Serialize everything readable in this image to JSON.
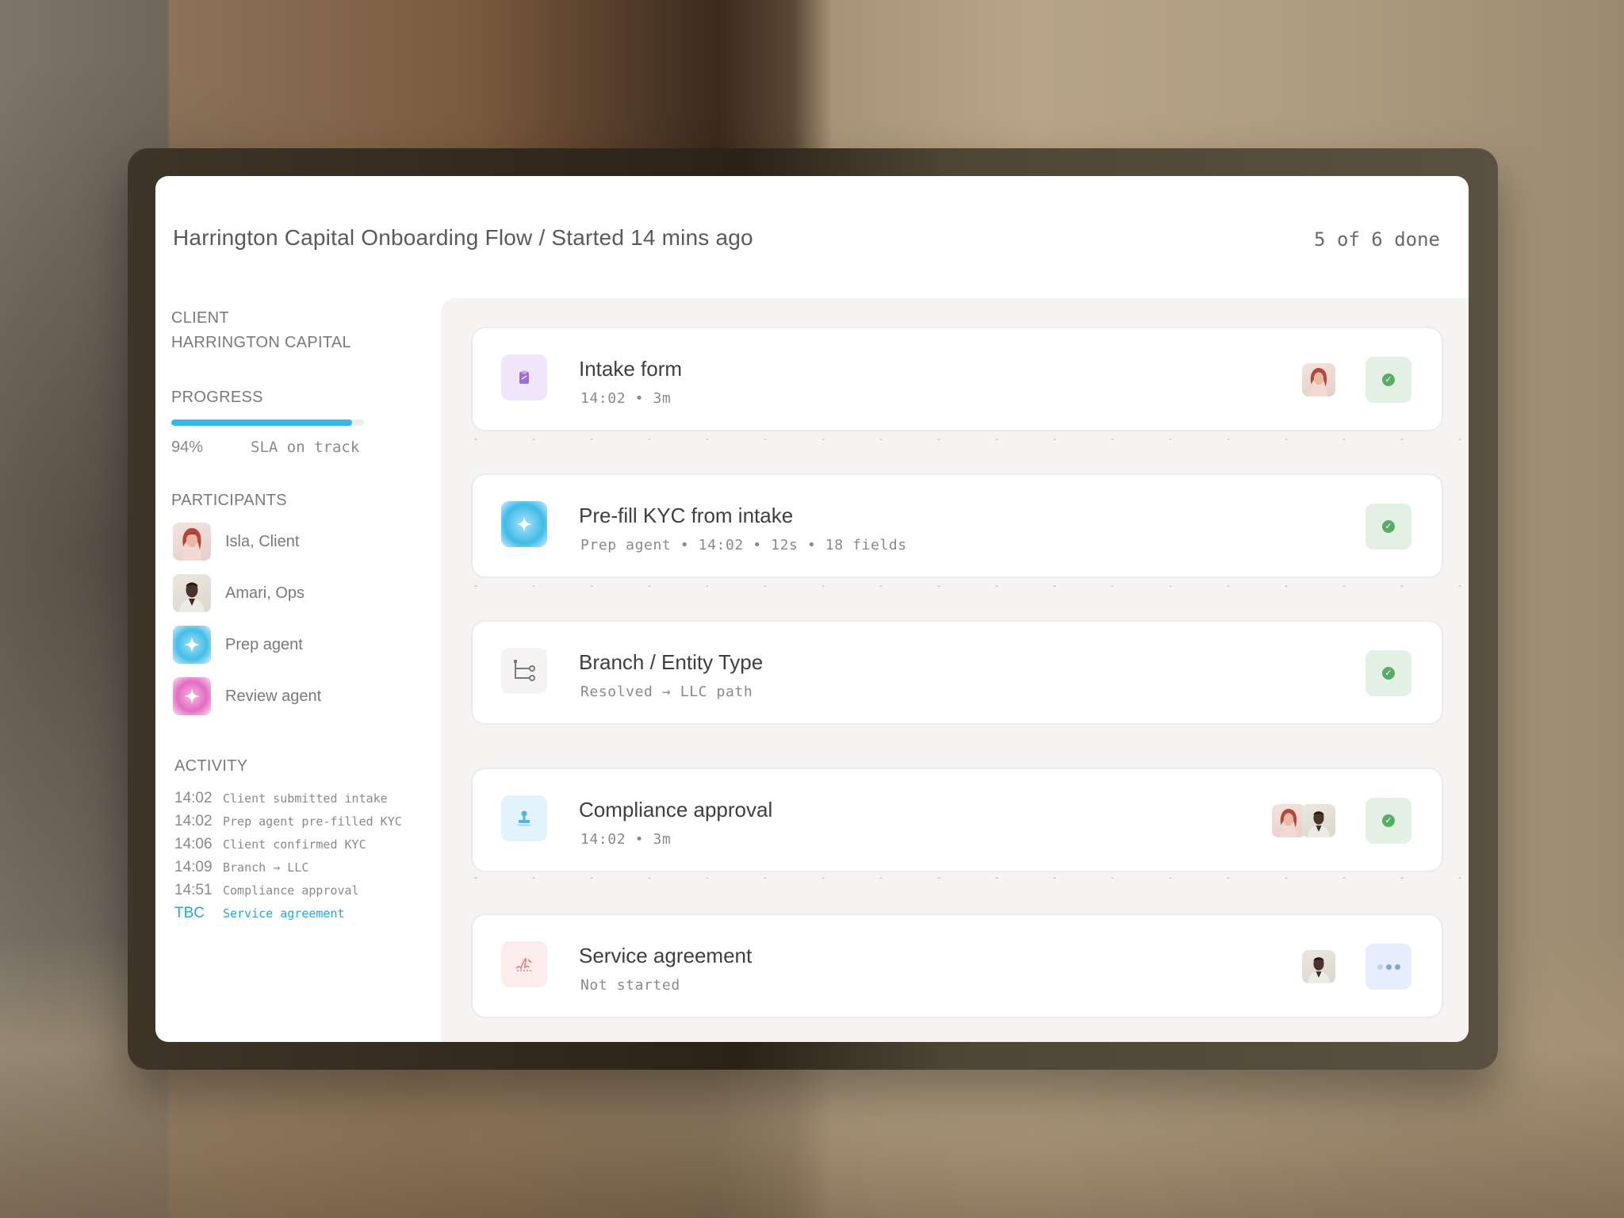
{
  "header": {
    "title": "Harrington Capital Onboarding Flow / Started 14 mins ago",
    "done_count": "5 of 6 done"
  },
  "sidebar": {
    "client_label": "CLIENT",
    "client_name": "HARRINGTON CAPITAL",
    "progress_label": "PROGRESS",
    "progress_value": 0.94,
    "progress_percent": "94%",
    "sla_text": "SLA on track",
    "participants_label": "PARTICIPANTS",
    "participants": [
      {
        "name": "Isla, Client",
        "icon": "isla-avatar"
      },
      {
        "name": "Amari, Ops",
        "icon": "amari-avatar"
      },
      {
        "name": "Prep agent",
        "icon": "sparkle-icon"
      },
      {
        "name": "Review agent",
        "icon": "sparkle-icon"
      }
    ],
    "activity_label": "ACTIVITY",
    "activity": [
      {
        "time": "14:02",
        "text": "Client submitted intake"
      },
      {
        "time": "14:02",
        "text": "Prep agent pre-filled KYC"
      },
      {
        "time": "14:06",
        "text": "Client confirmed KYC"
      },
      {
        "time": "14:09",
        "text": "Branch → LLC"
      },
      {
        "time": "14:51",
        "text": "Compliance approval"
      },
      {
        "time": "TBC",
        "text": "Service agreement"
      }
    ]
  },
  "steps": [
    {
      "title": "Intake form",
      "meta": "14:02 • 3m",
      "icon": "clipboard-icon",
      "status": "done"
    },
    {
      "title": "Pre-fill KYC from intake",
      "meta": "Prep agent • 14:02 • 12s • 18 fields",
      "icon": "sparkle-icon",
      "status": "done"
    },
    {
      "title": "Branch / Entity Type",
      "meta": "Resolved → LLC path",
      "icon": "branch-icon",
      "status": "done"
    },
    {
      "title": "Compliance approval",
      "meta": "14:02 • 3m",
      "icon": "stamp-icon",
      "status": "done"
    },
    {
      "title": "Service agreement",
      "meta": "Not started",
      "icon": "signature-icon",
      "status": "pending"
    }
  ],
  "colors": {
    "accent": "#35b8e6",
    "done_bg": "#e3f1e4",
    "done_check": "#59ab66",
    "pending_bg": "#e6edfc"
  }
}
